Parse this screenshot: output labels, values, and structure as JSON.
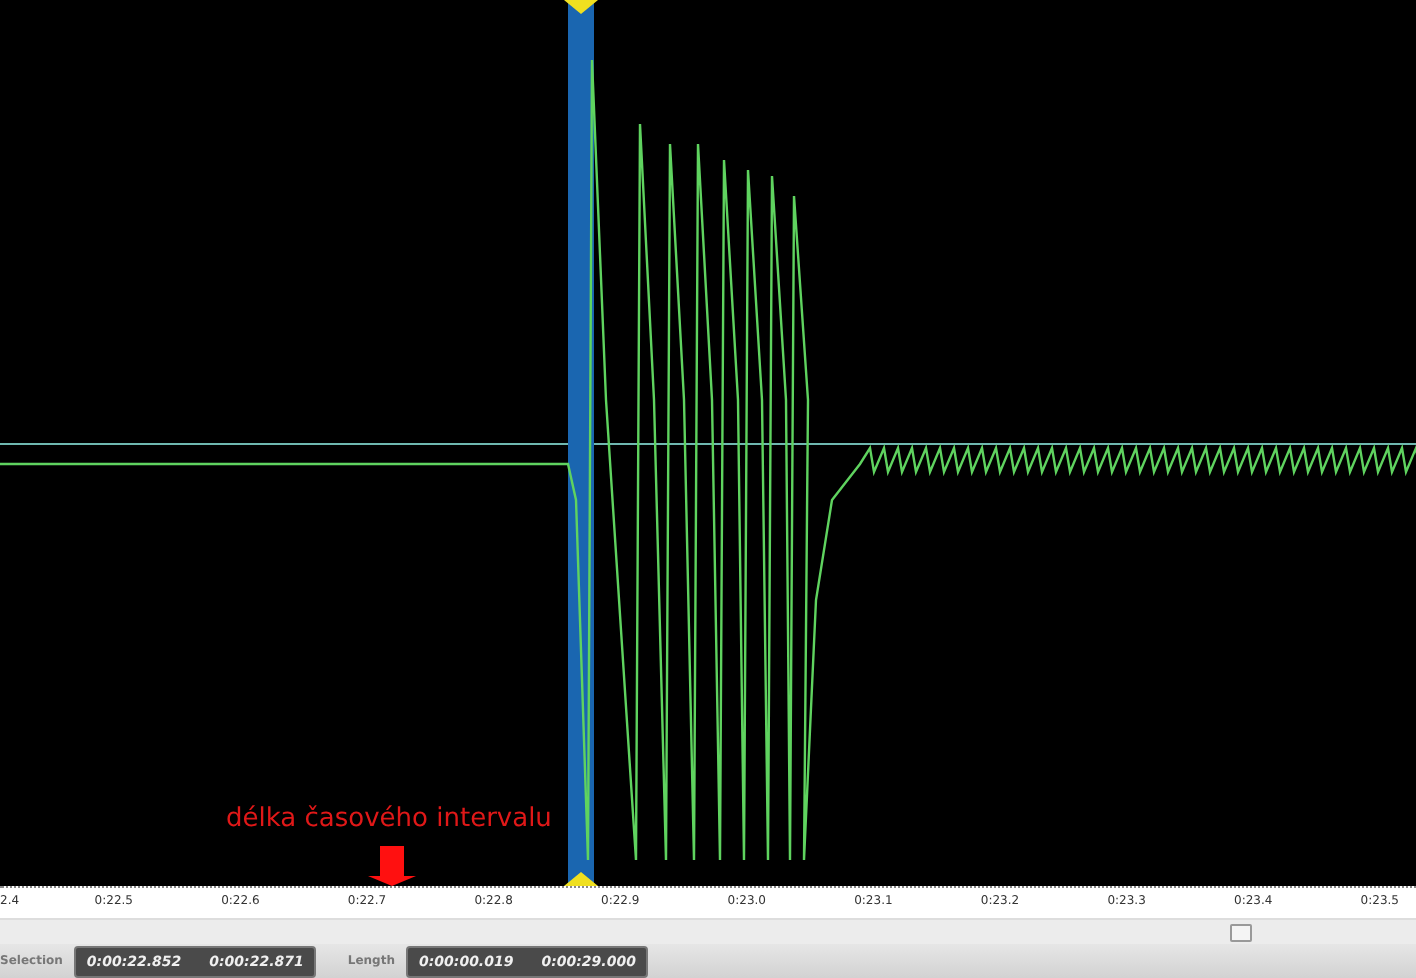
{
  "annotation": {
    "text": "délka časového intervalu"
  },
  "ruler": {
    "labels": [
      "2.4",
      "0:22.5",
      "0:22.6",
      "0:22.7",
      "0:22.8",
      "0:22.9",
      "0:23.0",
      "0:23.1",
      "0:23.2",
      "0:23.3",
      "0:23.4",
      "0:23.5"
    ]
  },
  "status_bar": {
    "selection_label": "Selection",
    "selection_start": "0:00:22.852",
    "selection_end": "0:00:22.871",
    "length_label": "Length",
    "length": "0:00:00.019",
    "total": "0:00:29.000"
  }
}
